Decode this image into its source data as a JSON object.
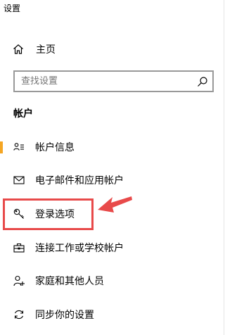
{
  "window": {
    "title": "设置"
  },
  "home": {
    "label": "主页",
    "icon": "home-icon"
  },
  "search": {
    "value": "",
    "placeholder": "查找设置",
    "icon": "search-icon"
  },
  "section": {
    "title": "帐户"
  },
  "nav": {
    "items": [
      {
        "label": "帐户信息",
        "icon": "person-card-icon",
        "selected": true
      },
      {
        "label": "电子邮件和应用帐户",
        "icon": "mail-icon",
        "selected": false
      },
      {
        "label": "登录选项",
        "icon": "key-icon",
        "selected": false
      },
      {
        "label": "连接工作或学校帐户",
        "icon": "briefcase-icon",
        "selected": false
      },
      {
        "label": "家庭和其他人员",
        "icon": "person-add-icon",
        "selected": false
      },
      {
        "label": "同步你的设置",
        "icon": "sync-icon",
        "selected": false
      }
    ]
  },
  "colors": {
    "accent": "#f5a623",
    "annotation": "#e84a4a",
    "search_border": "#999999"
  }
}
